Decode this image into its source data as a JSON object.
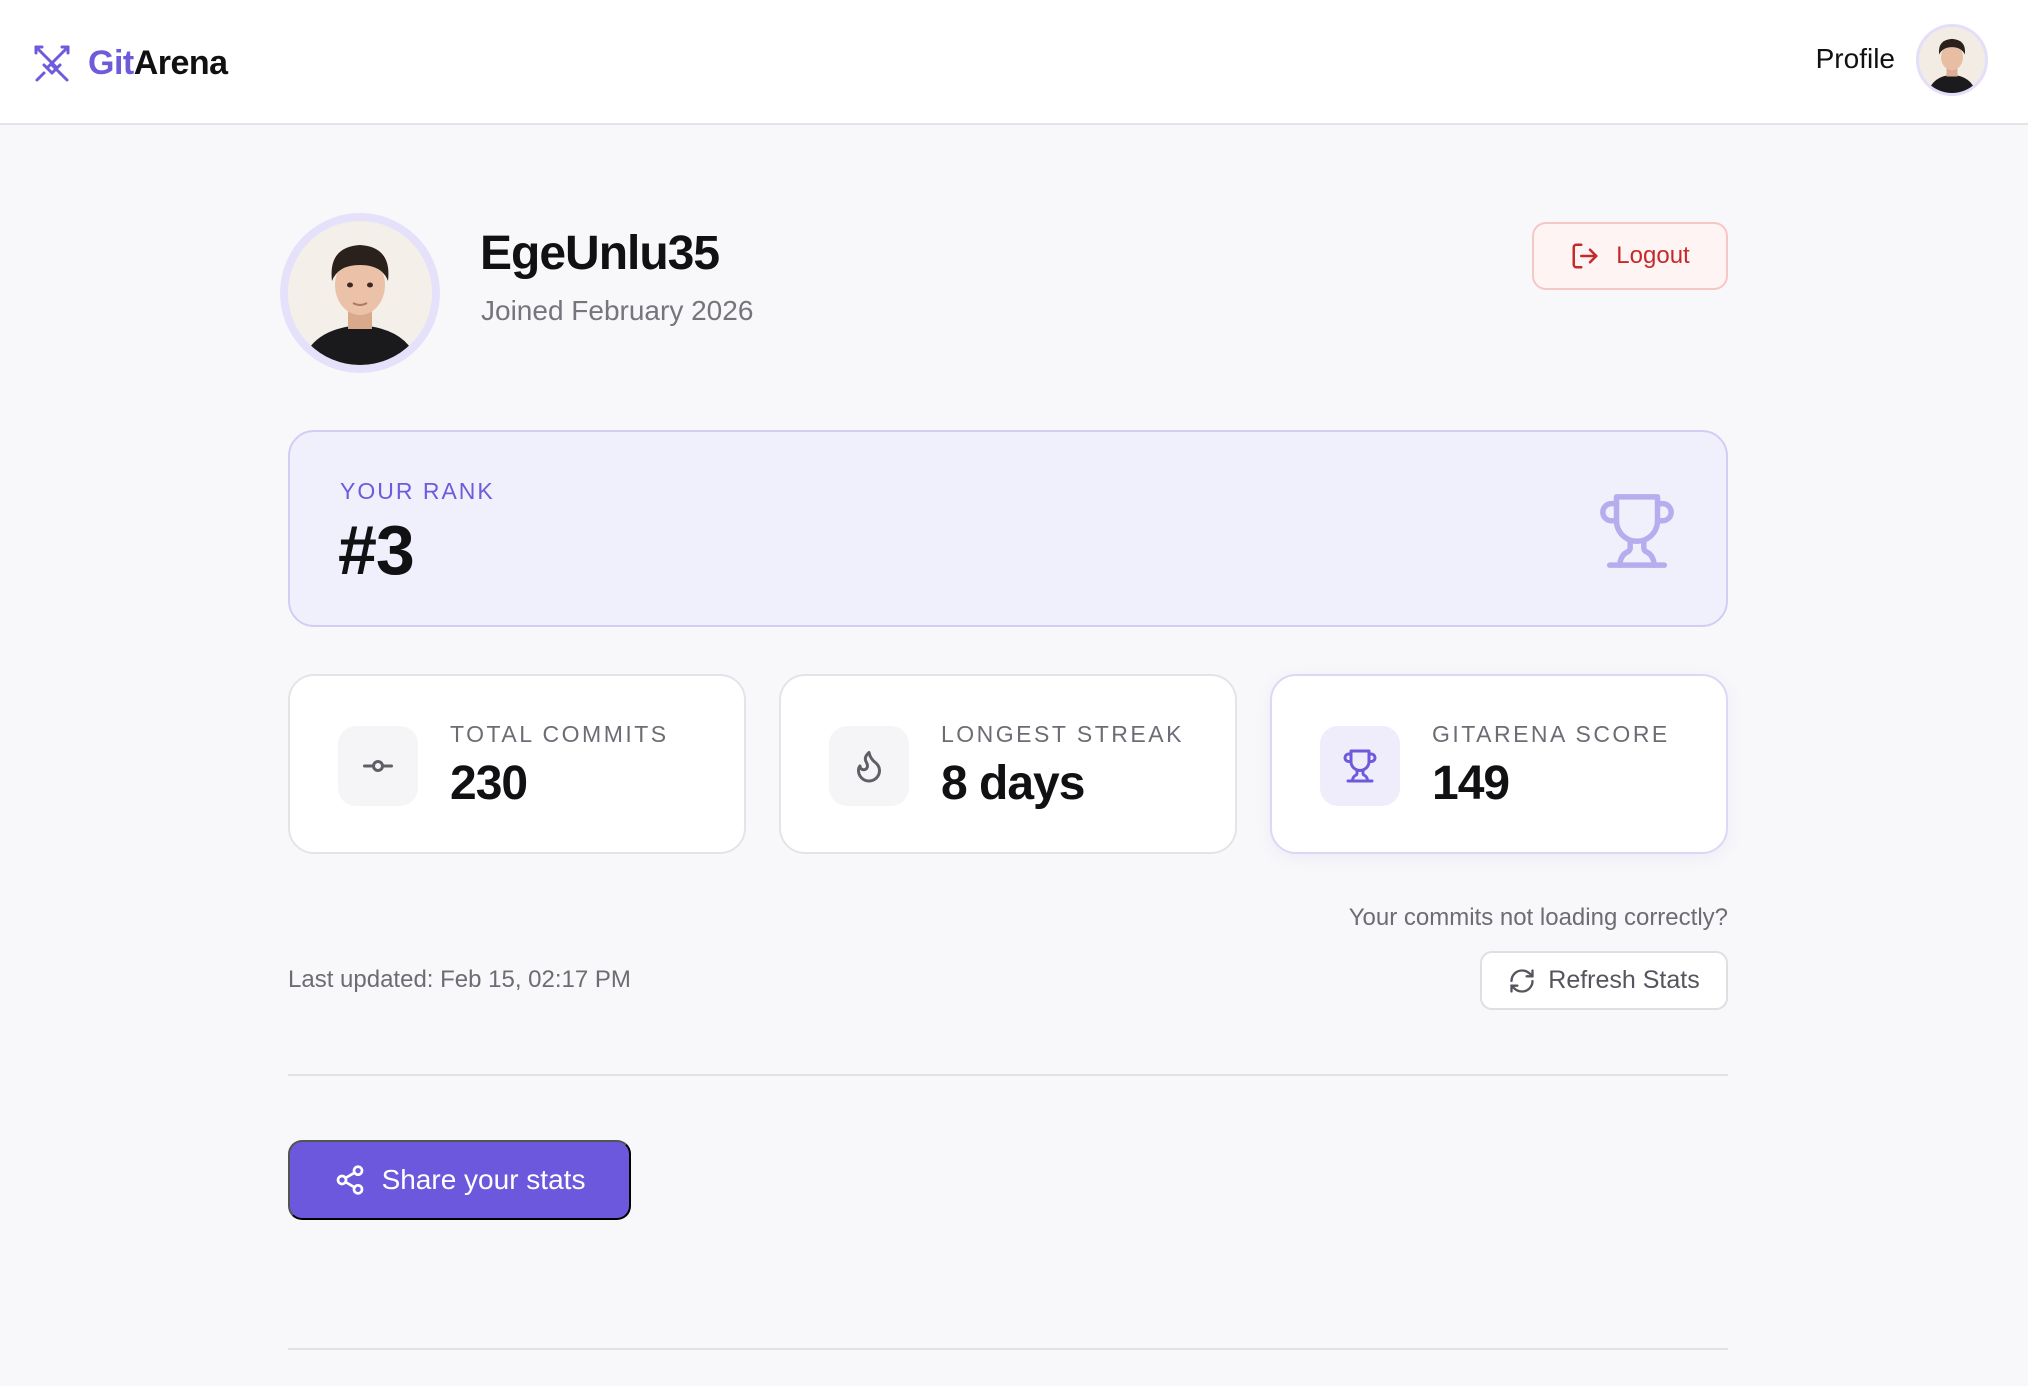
{
  "nav": {
    "brand_prefix": "Git",
    "brand_suffix": "Arena",
    "profile_label": "Profile"
  },
  "user": {
    "username": "EgeUnlu35",
    "joined": "Joined February 2026",
    "logout_label": "Logout"
  },
  "rank": {
    "label": "YOUR RANK",
    "value": "#3"
  },
  "stats": [
    {
      "label": "TOTAL COMMITS",
      "value": "230",
      "icon": "commit-icon"
    },
    {
      "label": "LONGEST STREAK",
      "value": "8 days",
      "icon": "flame-icon"
    },
    {
      "label": "GITARENA SCORE",
      "value": "149",
      "icon": "trophy-icon"
    }
  ],
  "refresh": {
    "question": "Your commits not loading correctly?",
    "last_updated": "Last updated: Feb 15, 02:17 PM",
    "button_label": "Refresh Stats"
  },
  "share": {
    "button_label": "Share your stats"
  },
  "colors": {
    "accent": "#6c58dd",
    "danger": "#c42a2a",
    "rank_bg": "#f0effc"
  }
}
